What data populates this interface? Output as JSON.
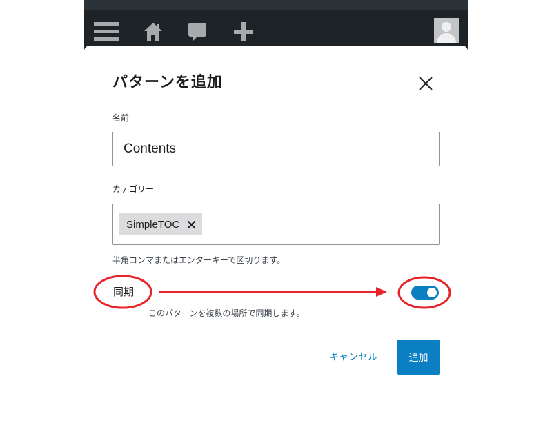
{
  "modal": {
    "title": "パターンを追加",
    "name_label": "名前",
    "name_value": "Contents",
    "category_label": "カテゴリー",
    "category_tokens": [
      "SimpleTOC"
    ],
    "category_help": "半角コンマまたはエンターキーで区切ります。",
    "sync_label": "同期",
    "sync_enabled": true,
    "sync_help": "このパターンを複数の場所で同期します。",
    "cancel_label": "キャンセル",
    "add_label": "追加"
  },
  "admin_bar": {
    "icons": [
      "menu-icon",
      "home-icon",
      "comment-icon",
      "plus-icon",
      "avatar"
    ]
  },
  "colors": {
    "accent": "#0a7fc1",
    "admin_bar": "#1d2327",
    "annotation": "#e8242b"
  }
}
